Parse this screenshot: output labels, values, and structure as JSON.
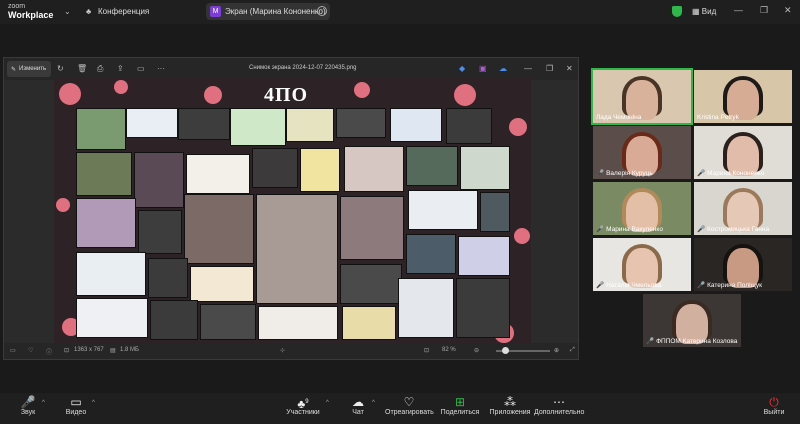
{
  "app": {
    "logo_line1": "zoom",
    "logo_line2": "Workplace"
  },
  "topbar": {
    "conference_label": "Конференция",
    "screen_share_label": "Экран (Марина Кононенко)",
    "screen_share_initial": "M",
    "view_label": "Вид"
  },
  "share_window": {
    "edit_button": "Изменить",
    "filename": "Снимок экрана 2024-12-07 220435.png",
    "image_title": "4ПО",
    "dimensions": "1363 x 767",
    "filesize": "1.8 МБ",
    "zoom": "82 %"
  },
  "participants": [
    {
      "name": "Лада Чемоніна",
      "muted": false,
      "active": true
    },
    {
      "name": "Kristina Petryk",
      "muted": false,
      "active": false
    },
    {
      "name": "Валерія Куруць",
      "muted": true,
      "active": false
    },
    {
      "name": "Марина Кононенко",
      "muted": true,
      "active": false
    },
    {
      "name": "Марина Вакуленко",
      "muted": true,
      "active": false
    },
    {
      "name": "Костромицька Ганна",
      "muted": true,
      "active": false
    },
    {
      "name": "Наталія Чмельова",
      "muted": true,
      "active": false
    },
    {
      "name": "Катерина Поліщук",
      "muted": true,
      "active": false
    },
    {
      "name": "ФППОМ Катерина Козлова",
      "muted": true,
      "active": false
    }
  ],
  "toolbar": {
    "audio": "Звук",
    "video": "Видео",
    "participants": "Участники",
    "participants_count": "9",
    "chat": "Чат",
    "react": "Отреагировать",
    "share": "Поделиться",
    "apps": "Приложения",
    "more": "Дополнительно",
    "leave": "Выйти"
  },
  "colors": {
    "accent_green": "#2eb84a",
    "mute_red": "#e33333",
    "splat_pink": "#e07080"
  }
}
